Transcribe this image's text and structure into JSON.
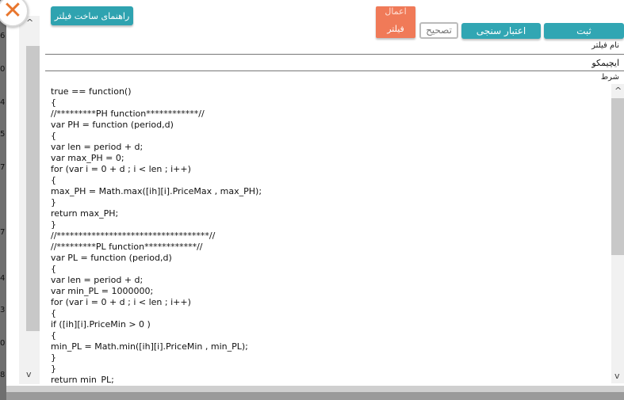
{
  "background": {
    "side_numbers": [
      "6",
      "0",
      "4",
      "5",
      "7",
      "7",
      "4",
      "3",
      "0",
      "8"
    ]
  },
  "dialog": {
    "close_glyph": "✕",
    "top_left_button": "راهنمای ساخت فیلتر",
    "buttons": {
      "submit": "ثبت",
      "validate": "اعتبار سنجی",
      "correct": "تصحیح",
      "apply_filter_top": "اعمال",
      "apply_filter_bottom": "فیلتر"
    },
    "name_label": "نام فیلتر",
    "name_value": "ایچیمکو",
    "condition_label": "شرط",
    "code": "true == function()\n{\n//*********PH function************//\nvar PH = function (period,d)\n{\nvar len = period + d;\nvar max_PH = 0;\nfor (var i = 0 + d ; i < len ; i++)\n{\nmax_PH = Math.max([ih][i].PriceMax , max_PH);\n}\nreturn max_PH;\n}\n//***********************************//\n//*********PL function************//\nvar PL = function (period,d)\n{\nvar len = period + d;\nvar min_PL = 1000000;\nfor (var i = 0 + d ; i < len ; i++)\n{\nif ([ih][i].PriceMin > 0 )\n{\nmin_PL = Math.min([ih][i].PriceMin , min_PL);\n}\n}\nreturn min_PL;",
    "scroll_up_glyph": "^",
    "scroll_down_glyph": "v"
  },
  "colors": {
    "teal_button": "#31a6b3",
    "orange_button": "#f07a58",
    "close_x": "#e8762d"
  }
}
